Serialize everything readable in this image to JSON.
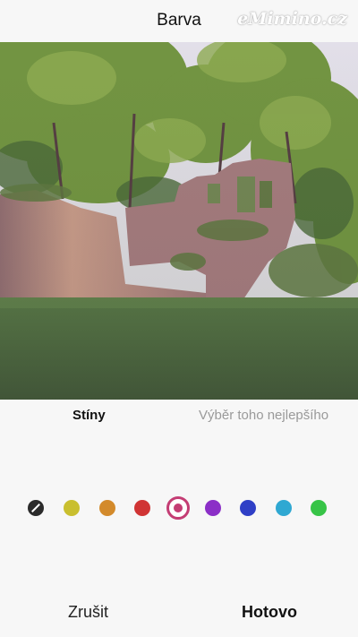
{
  "header": {
    "title": "Barva",
    "watermark": "eMimino.cz"
  },
  "photo": {
    "description_icon": "ruins-photo"
  },
  "tabs": {
    "shadows_label": "Stíny",
    "best_label": "Výběr toho nejlepšího",
    "active": "shadows"
  },
  "swatches": {
    "colors": [
      "none",
      "#c9bf2f",
      "#d38a2b",
      "#d03434",
      "#c43d74",
      "#8b2fc7",
      "#2f3fc6",
      "#2fa8d2",
      "#37c447"
    ],
    "selected_index": 4
  },
  "footer": {
    "cancel_label": "Zrušit",
    "done_label": "Hotovo"
  }
}
